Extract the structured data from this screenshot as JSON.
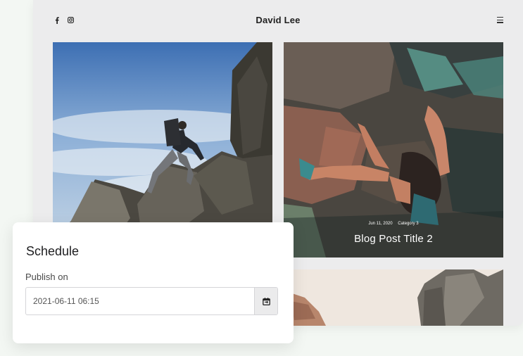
{
  "site": {
    "title": "David Lee",
    "social": [
      "facebook-icon",
      "instagram-icon"
    ],
    "menu_icon": "hamburger-menu-icon"
  },
  "posts": [
    {
      "image": "hiker on rocks under blue sky"
    },
    {
      "image": "climber on rock wall",
      "date": "Jun 11, 2020",
      "category": "Category 3",
      "title": "Blog Post Title 2"
    },
    {
      "image": "rock formations on a pale sky"
    }
  ],
  "schedule": {
    "title": "Schedule",
    "field_label": "Publish on",
    "value": "2021-06-11 06:15",
    "button_icon": "calendar-icon"
  },
  "colors": {
    "accent": "#1d1d1f",
    "page_bg": "#f3f7f3",
    "site_bg": "#ececed"
  }
}
